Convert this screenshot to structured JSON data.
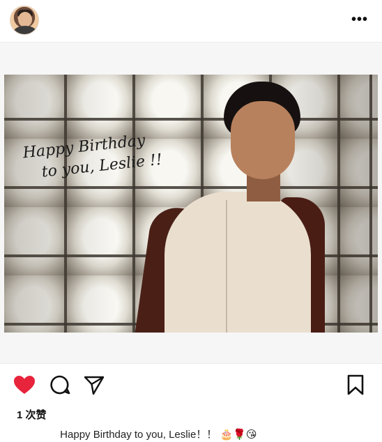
{
  "post": {
    "menu_icon": "more-horizontal-icon",
    "more_label": "•••",
    "handwriting": {
      "line1": "Happy Birthday",
      "line2": "to you, Leslie !!"
    },
    "actions": [
      {
        "name": "like",
        "icon": "heart-icon",
        "color": "#e8243c"
      },
      {
        "name": "comment",
        "icon": "comment-icon"
      },
      {
        "name": "share",
        "icon": "send-icon"
      },
      {
        "name": "save",
        "icon": "bookmark-icon"
      }
    ],
    "likes_text": "1 次赞",
    "caption_text": "Happy Birthday to you, Leslie！！",
    "caption_emojis": "🎂🌹😘"
  }
}
